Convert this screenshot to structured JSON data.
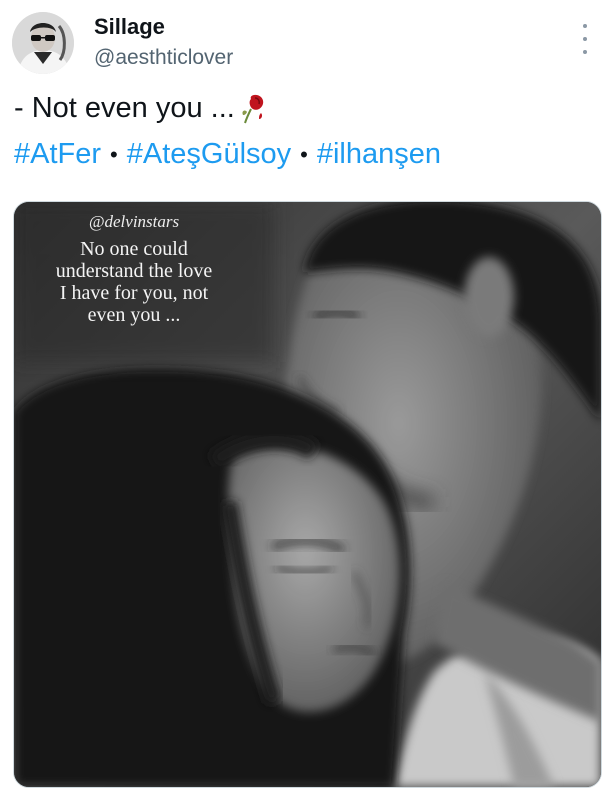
{
  "tweet": {
    "author_name": "Sillage",
    "author_handle": "@aesthticlover",
    "text": "- Not even you ...",
    "text_emoji": "wilted-rose-icon",
    "hashtags": [
      "#AtFer",
      "#AteşGülsoy",
      "#ilhanşen"
    ],
    "separator": "•"
  },
  "media": {
    "credit": "@delvinstars",
    "quote": [
      "No one could",
      "understand the love",
      "I have for you, not",
      "even you ..."
    ]
  },
  "colors": {
    "link": "#1d9bf0",
    "handle_gray": "#536471",
    "text": "#0f1419"
  }
}
